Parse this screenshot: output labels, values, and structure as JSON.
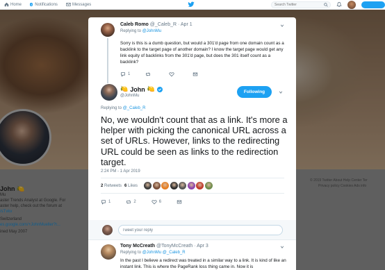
{
  "nav": {
    "home": "Home",
    "notifications": "Notifications",
    "notifications_badge": "4",
    "messages": "Messages",
    "search_placeholder": "Search Twitter",
    "accent": "#1da1f2"
  },
  "profile_bg": {
    "name": "John",
    "name_emoji": "🍋",
    "bio_lines": [
      "aster Trends Analyst at Google. For",
      "aster help, check out the forum at",
      "/sTvkv"
    ],
    "location": "Switzerland",
    "website": "es.google.com/+JohnMueller?r...",
    "joined": "ined May 2007",
    "footer_line1": "© 2019 Twitter   About   Help Center   Ter",
    "footer_line2": "Privacy policy   Cookies   Ads info"
  },
  "reply_tweet": {
    "author": "Caleb Romo",
    "handle": "@_Caleb_R",
    "date": "Apr 1",
    "replying_label": "Replying to",
    "replying_to": "@JohnMu",
    "body": "Sorry is this is a dumb question, but would a 301'd page from one domain count as a backlink to the target page of another domain? I know the target page would get any link equity of backlinks from the 301'd page, but does the 301 itself count as a backlink?",
    "reply_count": "1",
    "retweet_count": "",
    "like_count": ""
  },
  "main_tweet": {
    "author": "John",
    "name_emoji": "🍋",
    "handle": "@JohnMu",
    "follow_label": "Following",
    "replying_label": "Replying to",
    "replying_to": "@_Caleb_R",
    "body": "No, we wouldn't count that as a link. It's more a helper with picking the canonical URL across a set of URLs. However, links to the redirecting URL could be seen as links to the redirection target.",
    "timestamp": "2:24 PM - 1 Apr 2019",
    "retweets_count": "2",
    "retweets_label": "Retweets",
    "likes_count": "6",
    "likes_label": "Likes",
    "liker_colors": [
      "#3b3b3b",
      "#7a4f3a",
      "#e67e22",
      "#2d2d2d",
      "#555555",
      "#8e44ad",
      "#c0392b",
      "#6d8b4a"
    ],
    "reply_count": "1",
    "retweet_count": "2",
    "like_count": "6"
  },
  "compose": {
    "placeholder": "Tweet your reply"
  },
  "next_tweet": {
    "author": "Tony McCreath",
    "handle": "@TonyMcCreath",
    "date": "Apr 3",
    "replying_label": "Replying to",
    "replying_to": "@JohnMu @_Caleb_R",
    "body": "In the past I believe a redirect was treated in a similar way to a link. It is kind of like an instant link. This is where the PageRank loss thing came in. Now it is"
  }
}
